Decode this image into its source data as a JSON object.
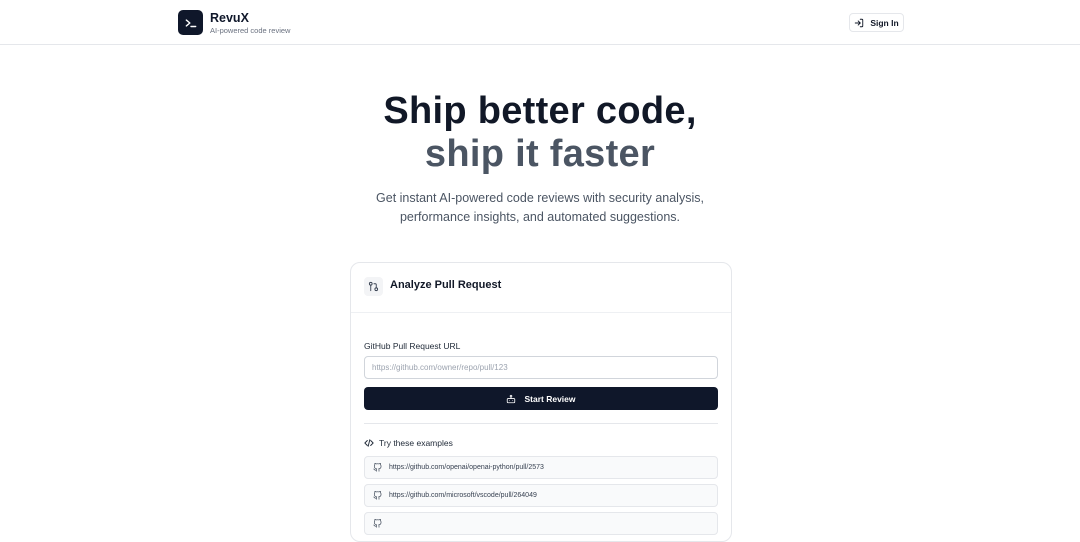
{
  "app": {
    "name": "RevuX",
    "tagline": "AI-powered code review"
  },
  "header": {
    "signin_label": "Sign In"
  },
  "hero": {
    "line1": "Ship better code,",
    "line2": "ship it faster",
    "subtitle_line1": "Get instant AI-powered code reviews with security analysis,",
    "subtitle_line2": "performance insights, and automated suggestions."
  },
  "card": {
    "title": "Analyze Pull Request",
    "field_label": "GitHub Pull Request URL",
    "input_placeholder": "https://github.com/owner/repo/pull/123",
    "input_value": "",
    "start_label": "Start Review",
    "examples_title": "Try these examples",
    "examples": [
      "https://github.com/openai/openai-python/pull/2573",
      "https://github.com/microsoft/vscode/pull/264049",
      ""
    ]
  },
  "colors": {
    "primary": "#0f172a",
    "muted_text": "#4b5563",
    "border": "#e5e7eb"
  },
  "icons": {
    "logo": "terminal-icon",
    "signin": "log-in-icon",
    "card": "git-pull-request-icon",
    "start": "bot-icon",
    "examples": "code-icon",
    "example_item": "github-icon"
  }
}
